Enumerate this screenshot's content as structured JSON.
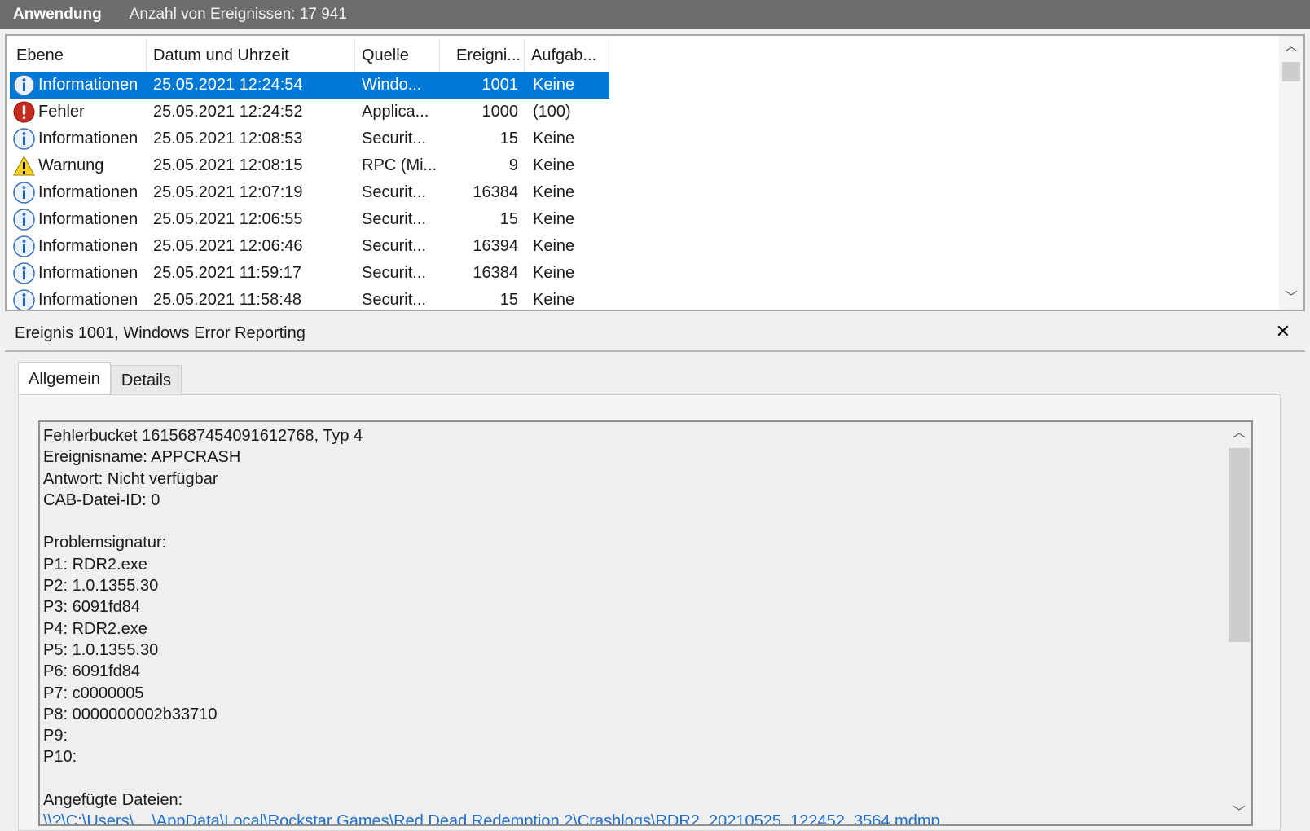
{
  "titlebar": {
    "log_name": "Anwendung",
    "event_count": "Anzahl von Ereignissen: 17 941"
  },
  "grid": {
    "columns": [
      "Ebene",
      "Datum und Uhrzeit",
      "Quelle",
      "Ereigni...",
      "Aufgab..."
    ],
    "rows": [
      {
        "level": "Informationen",
        "icon": "info-icon",
        "date": "25.05.2021 12:24:54",
        "source": "Windo...",
        "id": "1001",
        "task": "Keine",
        "selected": true
      },
      {
        "level": "Fehler",
        "icon": "error-icon",
        "date": "25.05.2021 12:24:52",
        "source": "Applica...",
        "id": "1000",
        "task": "(100)"
      },
      {
        "level": "Informationen",
        "icon": "info-icon",
        "date": "25.05.2021 12:08:53",
        "source": "Securit...",
        "id": "15",
        "task": "Keine"
      },
      {
        "level": "Warnung",
        "icon": "warning-icon",
        "date": "25.05.2021 12:08:15",
        "source": "RPC (Mi...",
        "id": "9",
        "task": "Keine"
      },
      {
        "level": "Informationen",
        "icon": "info-icon",
        "date": "25.05.2021 12:07:19",
        "source": "Securit...",
        "id": "16384",
        "task": "Keine"
      },
      {
        "level": "Informationen",
        "icon": "info-icon",
        "date": "25.05.2021 12:06:55",
        "source": "Securit...",
        "id": "15",
        "task": "Keine"
      },
      {
        "level": "Informationen",
        "icon": "info-icon",
        "date": "25.05.2021 12:06:46",
        "source": "Securit...",
        "id": "16394",
        "task": "Keine"
      },
      {
        "level": "Informationen",
        "icon": "info-icon",
        "date": "25.05.2021 11:59:17",
        "source": "Securit...",
        "id": "16384",
        "task": "Keine"
      },
      {
        "level": "Informationen",
        "icon": "info-icon",
        "date": "25.05.2021 11:58:48",
        "source": "Securit...",
        "id": "15",
        "task": "Keine"
      }
    ]
  },
  "detail": {
    "title": "Ereignis 1001, Windows Error Reporting",
    "close_glyph": "✕",
    "tabs": [
      "Allgemein",
      "Details"
    ],
    "lines": [
      "Fehlerbucket 1615687454091612768, Typ 4",
      "Ereignisname: APPCRASH",
      "Antwort: Nicht verfügbar",
      "CAB-Datei-ID: 0",
      "",
      "Problemsignatur:",
      "P1: RDR2.exe",
      "P2: 1.0.1355.30",
      "P3: 6091fd84",
      "P4: RDR2.exe",
      "P5: 1.0.1355.30",
      "P6: 6091fd84",
      "P7: c0000005",
      "P8: 0000000002b33710",
      "P9:",
      "P10:",
      "",
      "Angefügte Dateien:"
    ],
    "link_line": "\\\\?\\C:\\Users\\ ...\\AppData\\Local\\Rockstar Games\\Red Dead Redemption 2\\Crashlogs\\RDR2_20210525_122452_3564.mdmp"
  },
  "colors": {
    "titlebar_bg": "#6d6d6d",
    "selection": "#0078d7",
    "link": "#1e6fc9"
  }
}
